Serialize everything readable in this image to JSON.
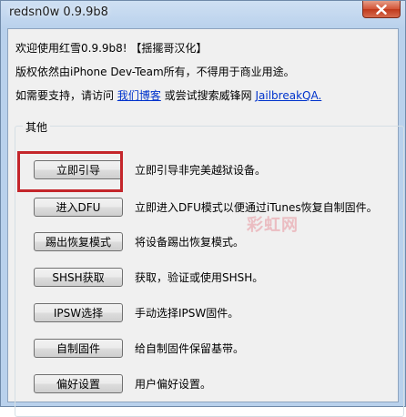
{
  "window": {
    "title": "redsn0w 0.9.9b8"
  },
  "info": {
    "line1": "欢迎使用红雪0.9.9b8! 【揺擺哥汉化】",
    "line2": "版权依然由iPhone Dev-Team所有，不得用于商业用途。",
    "line3_prefix": "如需要支持，请访问 ",
    "line3_link1": "我们博客",
    "line3_middle": " 或尝试搜索威锋网 ",
    "line3_link2": "JailbreakQA."
  },
  "group": {
    "title": "其他",
    "rows": [
      {
        "button": "立即引导",
        "desc": "立即引导非完美越狱设备。"
      },
      {
        "button": "进入DFU",
        "desc": "立即进入DFU模式以便通过iTunes恢复自制固件。"
      },
      {
        "button": "踢出恢复模式",
        "desc": "将设备踢出恢复模式。"
      },
      {
        "button": "SHSH获取",
        "desc": "获取，验证或使用SHSH。"
      },
      {
        "button": "IPSW选择",
        "desc": "手动选择IPSW固件。"
      },
      {
        "button": "自制固件",
        "desc": "给自制固件保留基带。"
      },
      {
        "button": "偏好设置",
        "desc": "用户偏好设置。"
      }
    ]
  },
  "watermark": "彩虹网",
  "colors": {
    "highlight": "#c4262b",
    "link": "#0033cc",
    "close_button": "#c0391b"
  }
}
